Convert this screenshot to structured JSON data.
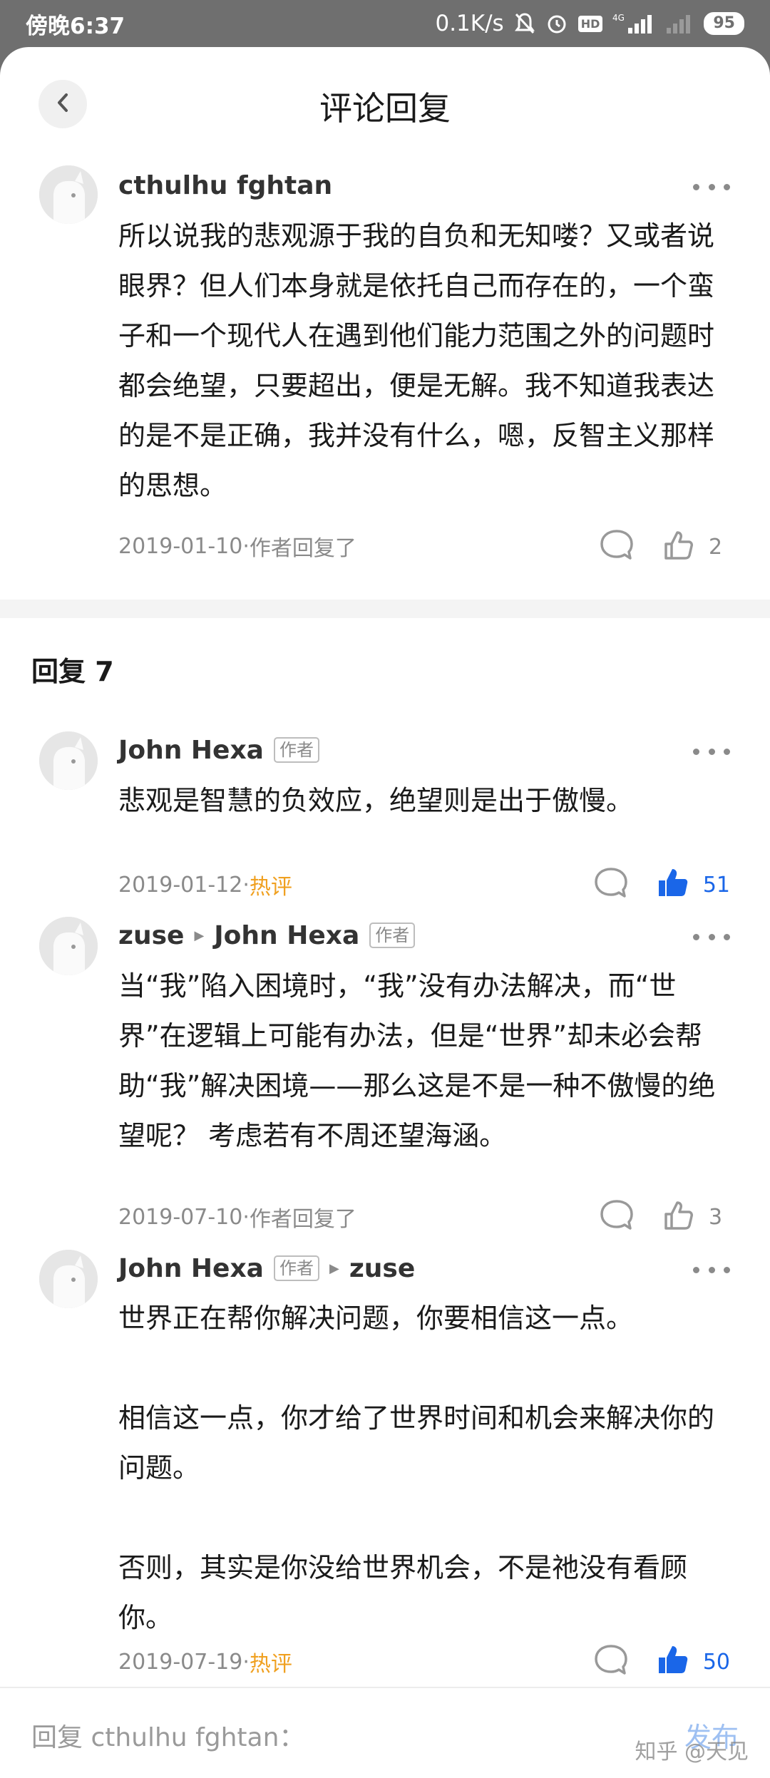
{
  "status_bar": {
    "time": "傍晚6:37",
    "net_speed": "0.1K/s",
    "hd": "HD",
    "signal": "4G",
    "battery": "95"
  },
  "header": {
    "title": "评论回复"
  },
  "main_comment": {
    "user": "cthulhu fghtan",
    "text": "所以说我的悲观源于我的自负和无知喽？又或者说眼界？但人们本身就是依托自己而存在的，一个蛮子和一个现代人在遇到他们能力范围之外的问题时都会绝望，只要超出，便是无解。我不知道我表达的是不是正确，我并没有什么，嗯，反智主义那样的思想。",
    "date": "2019-01-10",
    "meta_sep": " · ",
    "meta_extra": "作者回复了",
    "likes": "2"
  },
  "replies_header": "回复 7",
  "replies": [
    {
      "user": "John Hexa",
      "user_tag": "作者",
      "text": "悲观是智慧的负效应，绝望则是出于傲慢。",
      "date": "2019-01-12",
      "meta_sep": " · ",
      "meta_extra": "热评",
      "likes": "51",
      "liked": true
    },
    {
      "user": "zuse",
      "reply_to": "John Hexa",
      "reply_to_tag": "作者",
      "text": "当“我”陷入困境时，“我”没有办法解决，而“世界”在逻辑上可能有办法，但是“世界”却未必会帮助“我”解决困境——那么这是不是一种不傲慢的绝望呢？ 考虑若有不周还望海涵。",
      "date": "2019-07-10",
      "meta_sep": " · ",
      "meta_extra": "作者回复了",
      "likes": "3",
      "liked": false
    },
    {
      "user": "John Hexa",
      "user_tag": "作者",
      "reply_to": "zuse",
      "paragraphs": [
        "世界正在帮你解决问题，你要相信这一点。",
        "",
        "相信这一点，你才给了世界时间和机会来解决你的问题。",
        "",
        "否则，其实是你没给世界机会，不是祂没有看顾你。"
      ],
      "date": "2019-07-19",
      "meta_sep": " · ",
      "meta_extra": "热评",
      "likes": "50",
      "liked": true
    }
  ],
  "bottom_bar": {
    "placeholder": "回复 cthulhu fghtan：",
    "publish": "发布",
    "watermark": "知乎 @天见"
  },
  "colors": {
    "accent_blue": "#1a66e8",
    "hot_orange": "#f0a020",
    "muted": "#8a8a8a"
  },
  "icons": [
    "chevron-left-icon",
    "more-icon",
    "comment-bubble-icon",
    "thumb-up-icon",
    "thumb-up-filled-icon",
    "silent-bell-icon",
    "alarm-icon"
  ]
}
